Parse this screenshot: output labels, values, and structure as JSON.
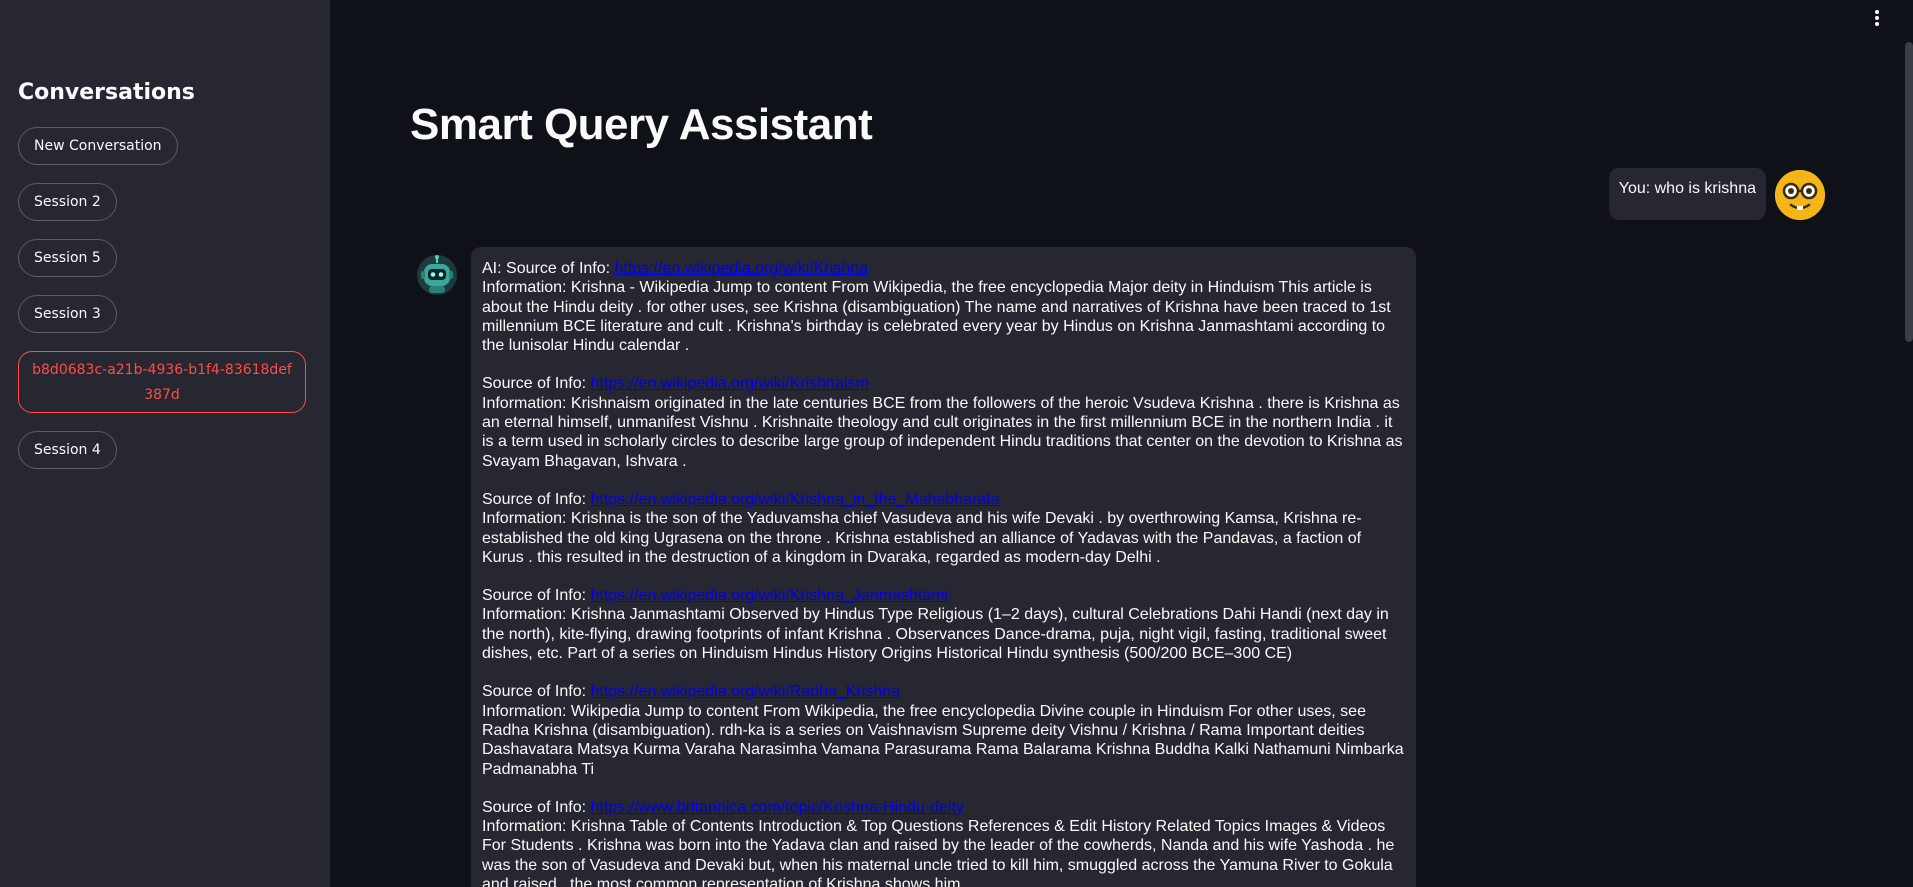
{
  "sidebar": {
    "title": "Conversations",
    "items": [
      {
        "label": "New Conversation"
      },
      {
        "label": "Session 2"
      },
      {
        "label": "Session 5"
      },
      {
        "label": "Session 3"
      },
      {
        "label": "b8d0683c-a21b-4936-b1f4-83618def387d",
        "active": true
      },
      {
        "label": "Session 4"
      }
    ]
  },
  "main": {
    "title": "Smart Query Assistant",
    "user_message": "You: who is krishna",
    "ai_prefix": "AI: ",
    "source_label": "Source of Info: ",
    "results": [
      {
        "url": "https://en.wikipedia.org/wiki/Krishna",
        "info": "Information: Krishna - Wikipedia Jump to content From Wikipedia, the free encyclopedia Major deity in Hinduism This article is about the Hindu deity . for other uses, see Krishna (disambiguation) The name and narratives of Krishna have been traced to 1st millennium BCE literature and cult . Krishna's birthday is celebrated every year by Hindus on Krishna Janmashtami according to the lunisolar Hindu calendar ."
      },
      {
        "url": "https://en.wikipedia.org/wiki/Krishnaism",
        "info": "Information: Krishnaism originated in the late centuries BCE from the followers of the heroic Vsudeva Krishna . there is Krishna as an eternal himself, unmanifest Vishnu . Krishnaite theology and cult originates in the first millennium BCE in the northern India . it is a term used in scholarly circles to describe large group of independent Hindu traditions that center on the devotion to Krishna as Svayam Bhagavan, Ishvara ."
      },
      {
        "url": "https://en.wikipedia.org/wiki/Krishna_in_the_Mahabharata",
        "info": "Information: Krishna is the son of the Yaduvamsha chief Vasudeva and his wife Devaki . by overthrowing Kamsa, Krishna re-established the old king Ugrasena on the throne . Krishna established an alliance of Yadavas with the Pandavas, a faction of Kurus . this resulted in the destruction of a kingdom in Dvaraka, regarded as modern-day Delhi ."
      },
      {
        "url": "https://en.wikipedia.org/wiki/Krishna_Janmashtami",
        "info": "Information: Krishna Janmashtami Observed by Hindus Type Religious (1–2 days), cultural Celebrations Dahi Handi (next day in the north), kite-flying, drawing footprints of infant Krishna . Observances Dance-drama, puja, night vigil, fasting, traditional sweet dishes, etc. Part of a series on Hinduism Hindus History Origins Historical Hindu synthesis (500/200 BCE–300 CE)"
      },
      {
        "url": "https://en.wikipedia.org/wiki/Radha_Krishna",
        "info": "Information: Wikipedia Jump to content From Wikipedia, the free encyclopedia Divine couple in Hinduism For other uses, see Radha Krishna (disambiguation). rdh-ka is a series on Vaishnavism Supreme deity Vishnu / Krishna / Rama Important deities Dashavatara Matsya Kurma Varaha Narasimha Vamana Parasurama Rama Balarama Krishna Buddha Kalki Nathamuni Nimbarka Padmanabha Ti"
      },
      {
        "url": "https://www.britannica.com/topic/Krishna-Hindu-deity",
        "info": "Information: Krishna Table of Contents Introduction & Top Questions References & Edit History Related Topics Images & Videos For Students . Krishna was born into the Yadava clan and raised by the leader of the cowherds, Nanda and his wife Yashoda . he was the son of Vasudeva and Devaki but, when his maternal uncle tried to kill him, smuggled across the Yamuna River to Gokula and raised . the most common representation of Krishna shows him"
      }
    ]
  },
  "icons": {
    "menu": "kebab-menu-icon",
    "user_avatar": "nerd-face-icon",
    "ai_avatar": "robot-icon"
  },
  "colors": {
    "sidebar_bg": "#262730",
    "main_bg": "#0e1117",
    "accent": "#ff4b4b",
    "link": "#0000ee",
    "user_avatar": "#f5b418",
    "ai_avatar": "#2a9d8f"
  }
}
